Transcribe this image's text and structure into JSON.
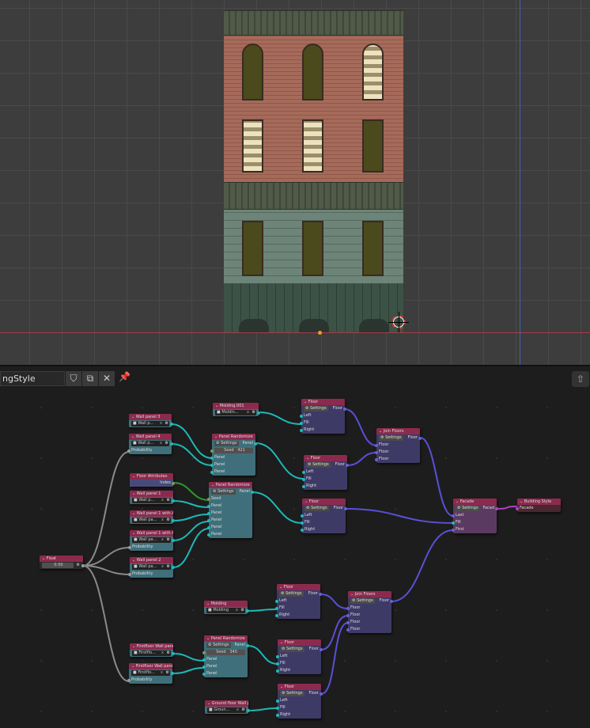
{
  "editor_header": {
    "tree_name": "ngStyle",
    "fake_user_icon": "shield-icon",
    "duplicate_icon": "copy-icon",
    "unlink_icon": "close-icon",
    "pin_icon": "pin-icon",
    "toggle_icon": "arrow-up-icon"
  },
  "colors": {
    "node_header": "#8c2a4e",
    "panel_body": "#3f6f7a",
    "floor_body": "#3e3a66",
    "facade_body": "#5b3a62",
    "wire_panel": "#1fb8b8",
    "wire_floor": "#5a50d8",
    "wire_float": "#8a8a8a",
    "wire_index": "#2f9a2f",
    "wire_facade": "#b040c0"
  },
  "nodes": [
    {
      "title": "Molding.001",
      "body": "panel",
      "rows": [
        {
          "k": "field",
          "t": "Moldin..."
        }
      ]
    },
    {
      "title": "Wall panel 3",
      "body": "panel",
      "rows": [
        {
          "k": "field",
          "t": "Wall p..."
        }
      ]
    },
    {
      "title": "Wall panel 4",
      "body": "panel",
      "rows": [
        {
          "k": "field",
          "t": "Wall p..."
        },
        {
          "k": "in",
          "t": "Probability"
        }
      ]
    },
    {
      "title": "Panel Randomize",
      "body": "panel",
      "rows": [
        {
          "k": "set",
          "t": "Settings",
          "o": "Panel"
        },
        {
          "k": "seed",
          "t": "Seed",
          "v": "421"
        },
        {
          "k": "in",
          "t": "Panel"
        },
        {
          "k": "in",
          "t": "Panel"
        },
        {
          "k": "in",
          "t": "Panel"
        }
      ]
    },
    {
      "title": "Floor Attributes",
      "body": "attr",
      "rows": [
        {
          "k": "out",
          "t": "Index"
        }
      ]
    },
    {
      "title": "Wall panel 1",
      "body": "panel",
      "rows": [
        {
          "k": "field",
          "t": "Wall p..."
        }
      ]
    },
    {
      "title": "Wall panel 1 with AC",
      "body": "panel",
      "rows": [
        {
          "k": "field",
          "t": "Wall pa..."
        }
      ]
    },
    {
      "title": "Wall panel 1 with A...",
      "body": "panel",
      "rows": [
        {
          "k": "field",
          "t": "Wall pa..."
        },
        {
          "k": "in",
          "t": "Probability"
        }
      ]
    },
    {
      "title": "Wall panel 2",
      "body": "panel",
      "rows": [
        {
          "k": "field",
          "t": "Wall pa..."
        },
        {
          "k": "in",
          "t": "Probability"
        }
      ]
    },
    {
      "title": "Panel Randomize",
      "body": "panel",
      "rows": [
        {
          "k": "set",
          "t": "Settings",
          "o": "Panel"
        },
        {
          "k": "in",
          "t": "Seed"
        },
        {
          "k": "in",
          "t": "Panel"
        },
        {
          "k": "in",
          "t": "Panel"
        },
        {
          "k": "in",
          "t": "Panel"
        },
        {
          "k": "in",
          "t": "Panel"
        },
        {
          "k": "in",
          "t": "Panel"
        }
      ]
    },
    {
      "title": "Float",
      "body": "float",
      "rows": [
        {
          "k": "value",
          "t": "0.50"
        }
      ]
    },
    {
      "title": "Floor",
      "body": "floor",
      "rows": [
        {
          "k": "set",
          "t": "Settings",
          "o": "Floor"
        },
        {
          "k": "in",
          "t": "Left"
        },
        {
          "k": "in",
          "t": "Fill"
        },
        {
          "k": "in",
          "t": "Right"
        }
      ]
    },
    {
      "title": "Join Floors",
      "body": "floor",
      "rows": [
        {
          "k": "set",
          "t": "Settings",
          "o": "Floor"
        },
        {
          "k": "in",
          "t": "Floor"
        },
        {
          "k": "in",
          "t": "Floor"
        },
        {
          "k": "in",
          "t": "Floor"
        }
      ]
    },
    {
      "title": "Floor",
      "body": "floor",
      "rows": [
        {
          "k": "set",
          "t": "Settings",
          "o": "Floor"
        },
        {
          "k": "in",
          "t": "Left"
        },
        {
          "k": "in",
          "t": "Fill"
        },
        {
          "k": "in",
          "t": "Right"
        }
      ]
    },
    {
      "title": "Floor",
      "body": "floor",
      "rows": [
        {
          "k": "set",
          "t": "Settings",
          "o": "Floor"
        },
        {
          "k": "in",
          "t": "Left"
        },
        {
          "k": "in",
          "t": "Fill"
        },
        {
          "k": "in",
          "t": "Right"
        }
      ]
    },
    {
      "title": "Facade",
      "body": "facade",
      "rows": [
        {
          "k": "set",
          "t": "Settings",
          "o": "Facad"
        },
        {
          "k": "in",
          "t": "Last"
        },
        {
          "k": "in",
          "t": "Fill"
        },
        {
          "k": "in",
          "t": "First"
        }
      ]
    },
    {
      "title": "Building Style",
      "body": "style",
      "rows": [
        {
          "k": "in",
          "t": "Facade"
        }
      ]
    },
    {
      "title": "Molding",
      "body": "panel",
      "rows": [
        {
          "k": "field",
          "t": "Molding"
        }
      ]
    },
    {
      "title": "Floor",
      "body": "floor",
      "rows": [
        {
          "k": "set",
          "t": "Settings",
          "o": "Floor"
        },
        {
          "k": "in",
          "t": "Left"
        },
        {
          "k": "in",
          "t": "Fill"
        },
        {
          "k": "in",
          "t": "Right"
        }
      ]
    },
    {
      "title": "Join Floors",
      "body": "floor",
      "rows": [
        {
          "k": "set",
          "t": "Settings",
          "o": "Floor"
        },
        {
          "k": "in",
          "t": "Floor"
        },
        {
          "k": "in",
          "t": "Floor"
        },
        {
          "k": "in",
          "t": "Floor"
        },
        {
          "k": "in",
          "t": "Floor"
        }
      ]
    },
    {
      "title": "Firstfloor Wall panel",
      "body": "panel",
      "rows": [
        {
          "k": "field",
          "t": "Firstflo..."
        }
      ]
    },
    {
      "title": "Firstfloor Wall pane",
      "body": "panel",
      "rows": [
        {
          "k": "field",
          "t": "Firstflo..."
        },
        {
          "k": "in",
          "t": "Probability"
        }
      ]
    },
    {
      "title": "Panel Randomize",
      "body": "panel",
      "rows": [
        {
          "k": "set",
          "t": "Settings",
          "o": "Panel"
        },
        {
          "k": "seed",
          "t": "Seed",
          "v": "340"
        },
        {
          "k": "in",
          "t": "Panel"
        },
        {
          "k": "in",
          "t": "Panel"
        },
        {
          "k": "in",
          "t": "Panel"
        }
      ]
    },
    {
      "title": "Floor",
      "body": "floor",
      "rows": [
        {
          "k": "set",
          "t": "Settings",
          "o": "Floor"
        },
        {
          "k": "in",
          "t": "Left"
        },
        {
          "k": "in",
          "t": "Fill"
        },
        {
          "k": "in",
          "t": "Right"
        }
      ]
    },
    {
      "title": "Floor",
      "body": "floor",
      "rows": [
        {
          "k": "set",
          "t": "Settings",
          "o": "Floor"
        },
        {
          "k": "in",
          "t": "Left"
        },
        {
          "k": "in",
          "t": "Fill"
        },
        {
          "k": "in",
          "t": "Right"
        }
      ]
    },
    {
      "title": "Ground floor Wall p",
      "body": "panel",
      "rows": [
        {
          "k": "field",
          "t": "Groun..."
        }
      ]
    }
  ]
}
